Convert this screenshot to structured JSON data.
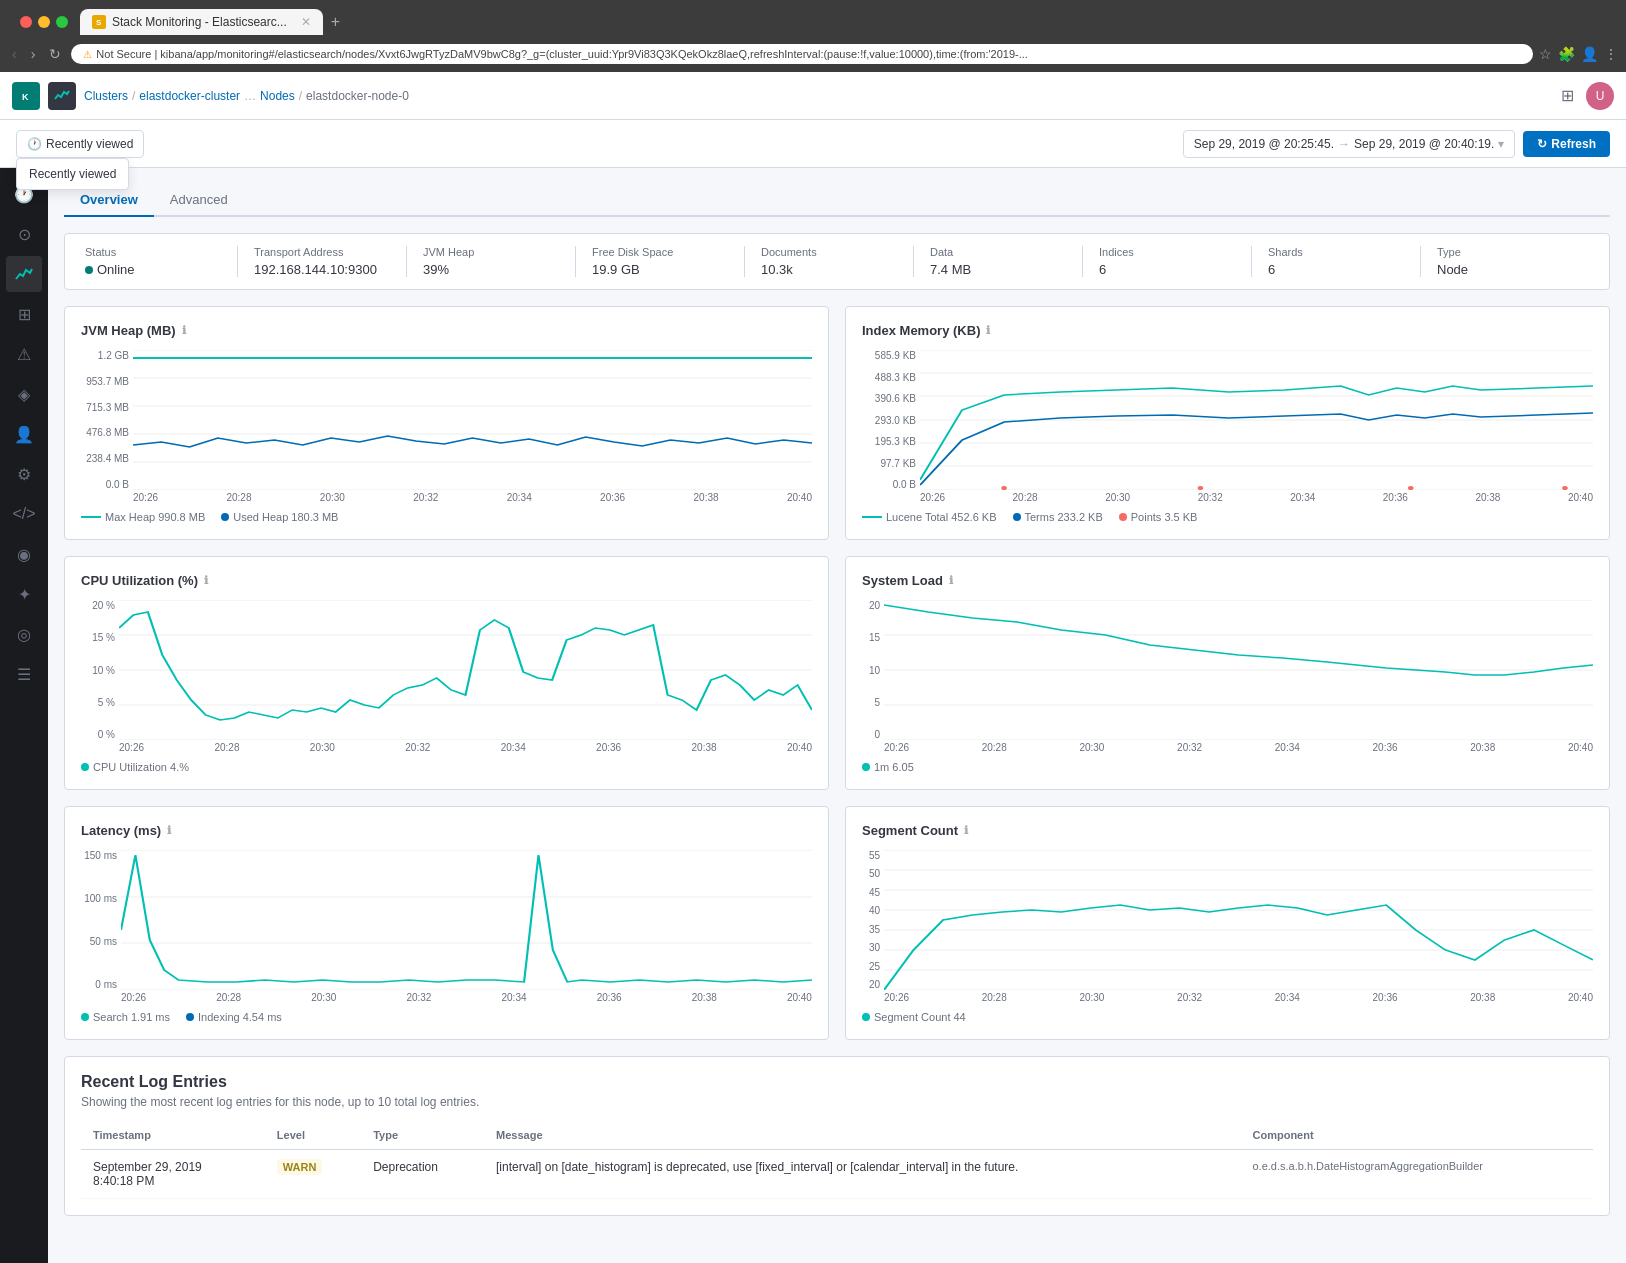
{
  "browser": {
    "tab_title": "Stack Monitoring - Elasticsearc...",
    "address": "Not Secure | kibana/app/monitoring#/elasticsearch/nodes/Xvxt6JwgRTyzDaMV9bwC8g?_g=(cluster_uuid:Ypr9Vi83Q3KQekOkz8laeQ,refreshInterval:(pause:!f,value:10000),time:(from:'2019-...",
    "new_tab_label": "+"
  },
  "header": {
    "breadcrumb": [
      "Clusters",
      "elastdocker-cluster",
      "Nodes",
      "elastdocker-node-0"
    ],
    "recently_viewed_label": "Recently viewed"
  },
  "toolbar": {
    "time_from": "Sep 29, 2019 @ 20:25:45.",
    "time_arrow": "→",
    "time_to": "Sep 29, 2019 @ 20:40:19.",
    "refresh_label": "Refresh"
  },
  "tabs": [
    {
      "label": "Overview",
      "active": true
    },
    {
      "label": "Advanced",
      "active": false
    }
  ],
  "stats": [
    {
      "label": "Status",
      "value": "Online",
      "type": "status"
    },
    {
      "label": "Transport Address",
      "value": "192.168.144.10:9300"
    },
    {
      "label": "JVM Heap",
      "value": "39%"
    },
    {
      "label": "Free Disk Space",
      "value": "19.9 GB"
    },
    {
      "label": "Documents",
      "value": "10.3k"
    },
    {
      "label": "Data",
      "value": "7.4 MB"
    },
    {
      "label": "Indices",
      "value": "6"
    },
    {
      "label": "Shards",
      "value": "6"
    },
    {
      "label": "Type",
      "value": "Node"
    }
  ],
  "charts": [
    {
      "id": "jvm-heap",
      "title": "JVM Heap (MB)",
      "y_labels": [
        "1.2 GB",
        "953.7 MB",
        "715.3 MB",
        "476.8 MB",
        "238.4 MB",
        "0.0 B"
      ],
      "x_labels": [
        "20:26",
        "20:28",
        "20:30",
        "20:32",
        "20:34",
        "20:36",
        "20:38",
        "20:40"
      ],
      "legend": [
        {
          "color": "#00bfb3",
          "label": "Max Heap  990.8 MB",
          "type": "line"
        },
        {
          "color": "#006bb4",
          "label": "Used Heap  180.3 MB",
          "type": "line"
        }
      ]
    },
    {
      "id": "index-memory",
      "title": "Index Memory (KB)",
      "y_labels": [
        "585.9 KB",
        "488.3 KB",
        "390.6 KB",
        "293.0 KB",
        "195.3 KB",
        "97.7 KB",
        "0.0 B"
      ],
      "x_labels": [
        "20:26",
        "20:28",
        "20:30",
        "20:32",
        "20:34",
        "20:36",
        "20:38",
        "20:40"
      ],
      "legend": [
        {
          "color": "#00bfb3",
          "label": "Lucene Total  452.6 KB",
          "type": "line"
        },
        {
          "color": "#006bb4",
          "label": "Terms  233.2 KB",
          "type": "line"
        },
        {
          "color": "#f86b63",
          "label": "Points  3.5 KB",
          "type": "dot"
        }
      ]
    },
    {
      "id": "cpu-util",
      "title": "CPU Utilization (%)",
      "y_labels": [
        "20 %",
        "15 %",
        "10 %",
        "5 %",
        "0 %"
      ],
      "x_labels": [
        "20:26",
        "20:28",
        "20:30",
        "20:32",
        "20:34",
        "20:36",
        "20:38",
        "20:40"
      ],
      "legend": [
        {
          "color": "#00bfb3",
          "label": "CPU Utilization  4.%",
          "type": "line"
        }
      ]
    },
    {
      "id": "system-load",
      "title": "System Load",
      "y_labels": [
        "20",
        "15",
        "10",
        "5",
        "0"
      ],
      "x_labels": [
        "20:26",
        "20:28",
        "20:30",
        "20:32",
        "20:34",
        "20:36",
        "20:38",
        "20:40"
      ],
      "legend": [
        {
          "color": "#00bfb3",
          "label": "1m  6.05",
          "type": "line"
        }
      ]
    },
    {
      "id": "latency",
      "title": "Latency (ms)",
      "y_labels": [
        "150 ms",
        "100 ms",
        "50 ms",
        "0 ms"
      ],
      "x_labels": [
        "20:26",
        "20:28",
        "20:30",
        "20:32",
        "20:34",
        "20:36",
        "20:38",
        "20:40"
      ],
      "legend": [
        {
          "color": "#00bfb3",
          "label": "Search  1.91 ms",
          "type": "line"
        },
        {
          "color": "#006bb4",
          "label": "Indexing  4.54 ms",
          "type": "line"
        }
      ]
    },
    {
      "id": "segment-count",
      "title": "Segment Count",
      "y_labels": [
        "55",
        "50",
        "45",
        "40",
        "35",
        "30",
        "25",
        "20"
      ],
      "x_labels": [
        "20:26",
        "20:28",
        "20:30",
        "20:32",
        "20:34",
        "20:36",
        "20:38",
        "20:40"
      ],
      "legend": [
        {
          "color": "#00bfb3",
          "label": "Segment Count  44",
          "type": "line"
        }
      ]
    }
  ],
  "logs": {
    "title": "Recent Log Entries",
    "subtitle": "Showing the most recent log entries for this node, up to 10 total log entries.",
    "columns": [
      "Timestamp",
      "Level",
      "Type",
      "Message",
      "Component"
    ],
    "rows": [
      {
        "timestamp": "September 29, 2019\n8:40:18 PM",
        "level": "WARN",
        "type": "Deprecation",
        "message": "[interval] on [date_histogram] is deprecated, use [fixed_interval] or [calendar_interval] in the future.",
        "component": "o.e.d.s.a.b.h.DateHistogramAggregationBuilder"
      }
    ]
  },
  "sidebar_icons": [
    {
      "name": "clock-icon",
      "symbol": "🕐"
    },
    {
      "name": "home-icon",
      "symbol": "⊙"
    },
    {
      "name": "chart-icon",
      "symbol": "↗"
    },
    {
      "name": "list-icon",
      "symbol": "☰"
    },
    {
      "name": "alert-icon",
      "symbol": "⚠"
    },
    {
      "name": "stack-icon",
      "symbol": "⬡"
    },
    {
      "name": "people-icon",
      "symbol": "👤"
    },
    {
      "name": "gear-icon",
      "symbol": "⚙"
    },
    {
      "name": "dev-icon",
      "symbol": "◈"
    },
    {
      "name": "map-icon",
      "symbol": "◉"
    },
    {
      "name": "ml-icon",
      "symbol": "✦"
    },
    {
      "name": "apm-icon",
      "symbol": "◎"
    },
    {
      "name": "settings-icon",
      "symbol": "⊞"
    }
  ],
  "colors": {
    "teal": "#00bfb3",
    "blue": "#006bb4",
    "red": "#f86b63",
    "accent": "#0071c2"
  }
}
